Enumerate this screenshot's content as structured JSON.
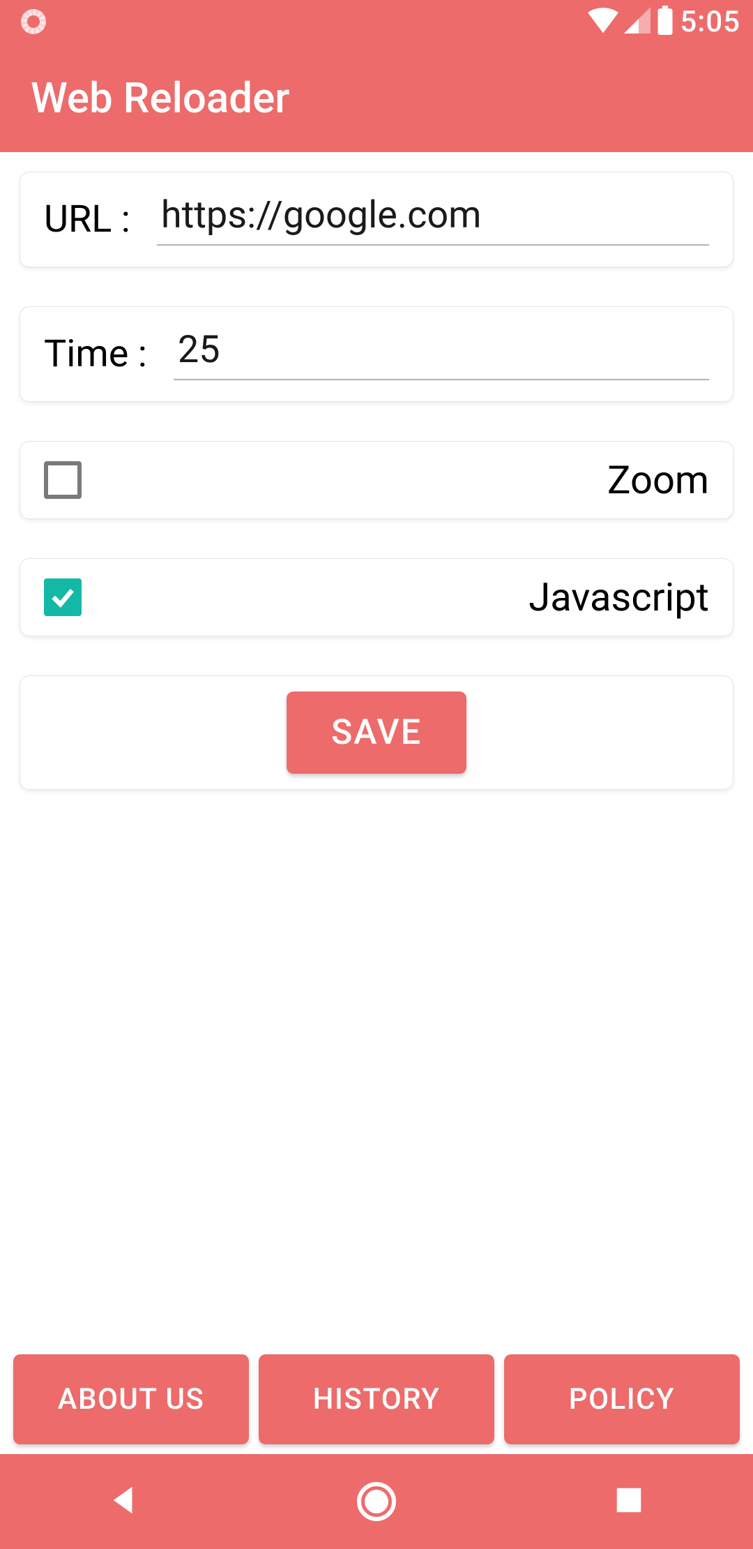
{
  "status": {
    "time": "5:05"
  },
  "app": {
    "title": "Web Reloader"
  },
  "form": {
    "url_label": "URL :",
    "url_value": "https://google.com",
    "time_label": "Time :",
    "time_value": "25",
    "zoom_label": "Zoom",
    "zoom_checked": false,
    "javascript_label": "Javascript",
    "javascript_checked": true,
    "save_label": "SAVE"
  },
  "footer": {
    "about": "ABOUT US",
    "history": "HISTORY",
    "policy": "POLICY"
  },
  "colors": {
    "accent": "#ED6B6B",
    "teal": "#14b8a6"
  }
}
